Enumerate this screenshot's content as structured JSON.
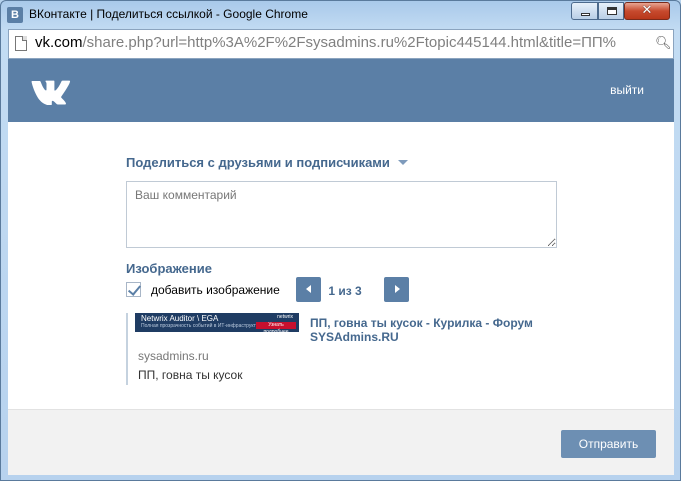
{
  "window": {
    "title": "ВКонтакте | Поделиться ссылкой - Google Chrome",
    "app_icon_letter": "В"
  },
  "addressbar": {
    "host": "vk.com",
    "path": "/share.php?url=http%3A%2F%2Fsysadmins.ru%2Ftopic445144.html&title=ПП%"
  },
  "header": {
    "logout_label": "выйти"
  },
  "share": {
    "audience_label": "Поделиться с друзьями и подписчиками",
    "comment_placeholder": "Ваш комментарий"
  },
  "image": {
    "section_label": "Изображение",
    "add_image_label": "добавить изображение",
    "add_image_checked": true,
    "pager_text": "1 из 3"
  },
  "preview": {
    "banner_title": "Netwrix Auditor \\ EGA",
    "banner_subtitle": "Полная прозрачность событий в ИТ-инфраструктуре",
    "banner_brand": "netwrix",
    "banner_badge": "Узнать подробнее",
    "link_title": "ПП, говна ты кусок - Курилка - Форум SYSAdmins.RU",
    "domain": "sysadmins.ru",
    "description": "ПП, говна ты кусок"
  },
  "footer": {
    "submit_label": "Отправить"
  },
  "colors": {
    "vk_blue": "#5b7fa6",
    "link_blue": "#45688e",
    "button_blue": "#6d8fb3"
  }
}
